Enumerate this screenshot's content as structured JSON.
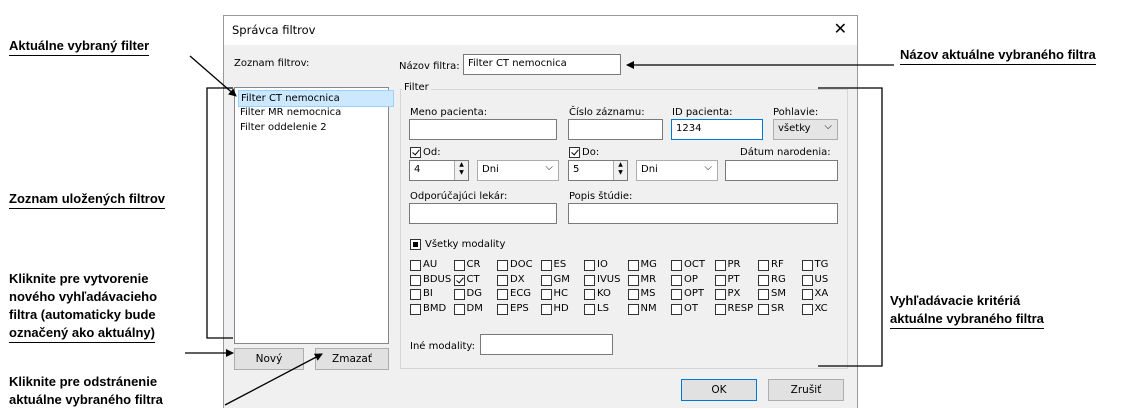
{
  "callouts": {
    "selected_filter": "Aktuálne vybraný filter",
    "filter_name": "Názov aktuálne vybraného filtra",
    "saved_filters": "Zoznam uložených filtrov",
    "new_line1": "Kliknite pre vytvorenie",
    "new_line2": "nového vyhľadávacieho",
    "new_line3": "filtra (automaticky bude",
    "new_line4": "označený ako aktuálny)",
    "delete_line1": "Kliknite pre odstránenie",
    "delete_line2": "aktuálne vybraného filtra",
    "criteria_line1": "Vyhľadávacie kritériá",
    "criteria_line2": "aktuálne vybraného filtra"
  },
  "dialog": {
    "title": "Správca filtrov",
    "close_glyph": "✕",
    "list_label": "Zoznam filtrov:",
    "filters": [
      "Filter CT nemocnica",
      "Filter MR nemocnica",
      "Filter oddelenie 2"
    ],
    "selected_index": 0,
    "new_button": "Nový",
    "delete_button": "Zmazať",
    "name_label": "Názov filtra:",
    "name_value": "Filter CT nemocnica",
    "group_label": "Filter",
    "patient_name_label": "Meno pacienta:",
    "patient_name_value": "",
    "record_no_label": "Číslo záznamu:",
    "record_no_value": "",
    "patient_id_label": "ID pacienta:",
    "patient_id_value": "1234",
    "sex_label": "Pohlavie:",
    "sex_value": "všetky",
    "from_label": "Od:",
    "from_checked": true,
    "from_value": "4",
    "from_unit": "Dni",
    "to_label": "Do:",
    "to_checked": true,
    "to_value": "5",
    "to_unit": "Dni",
    "birth_label": "Dátum narodenia:",
    "birth_value": "",
    "referring_label": "Odporúčajúci lekár:",
    "referring_value": "",
    "study_desc_label": "Popis štúdie:",
    "study_desc_value": "",
    "all_modalities_label": "Všetky modality",
    "modalities": [
      [
        "AU",
        "CR",
        "DOC",
        "ES",
        "IO",
        "MG",
        "OCT",
        "PR",
        "RF",
        "TG"
      ],
      [
        "BDUS",
        "CT",
        "DX",
        "GM",
        "IVUS",
        "MR",
        "OP",
        "PT",
        "RG",
        "US"
      ],
      [
        "BI",
        "DG",
        "ECG",
        "HC",
        "KO",
        "MS",
        "OPT",
        "PX",
        "SM",
        "XA"
      ],
      [
        "BMD",
        "DM",
        "EPS",
        "HD",
        "LS",
        "NM",
        "OT",
        "RESP",
        "SR",
        "XC"
      ]
    ],
    "checked_modalities": [
      "CT"
    ],
    "other_modalities_label": "Iné modality:",
    "other_modalities_value": "",
    "ok_button": "OK",
    "cancel_button": "Zrušiť"
  }
}
